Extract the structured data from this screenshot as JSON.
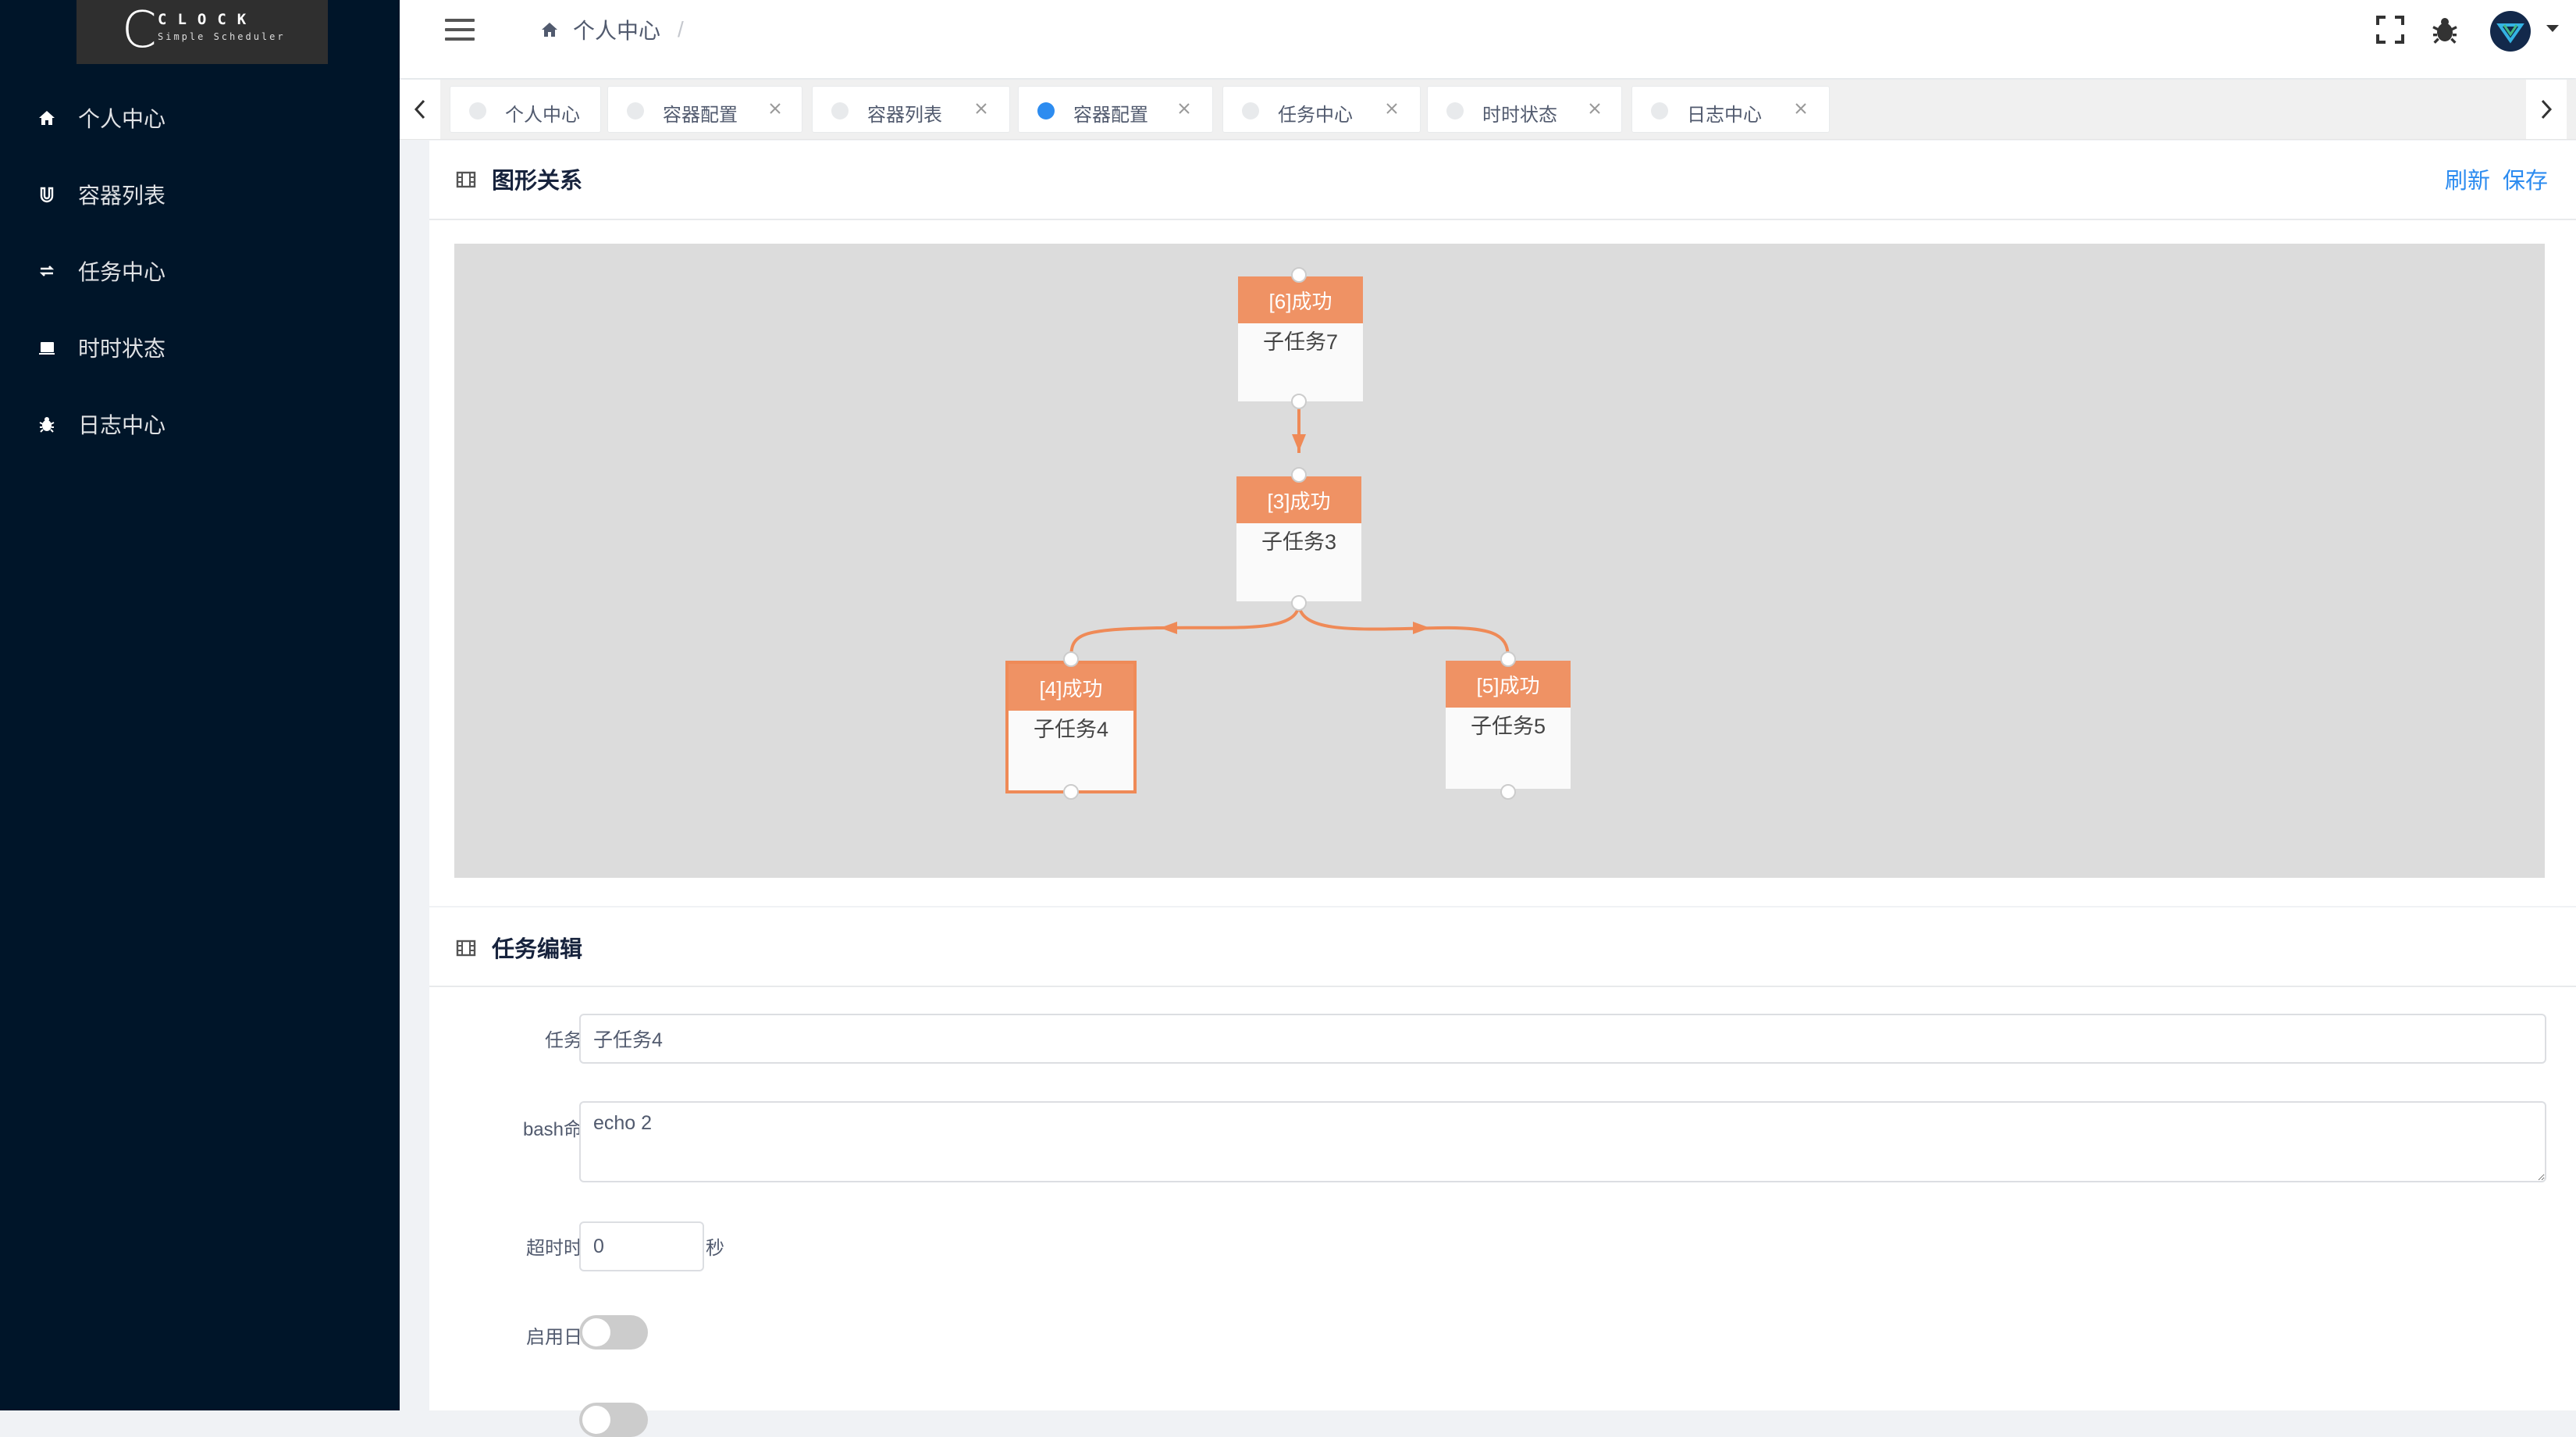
{
  "sidebar": {
    "logo": {
      "letter": "C",
      "word": "CLOCK",
      "subtitle": "Simple Scheduler"
    },
    "items": [
      {
        "label": "个人中心",
        "icon": "home-icon"
      },
      {
        "label": "容器列表",
        "icon": "magnet-icon"
      },
      {
        "label": "任务中心",
        "icon": "refresh-icon"
      },
      {
        "label": "时时状态",
        "icon": "monitor-icon"
      },
      {
        "label": "日志中心",
        "icon": "bug-icon"
      }
    ]
  },
  "header": {
    "breadcrumb": {
      "label": "个人中心",
      "separator": "/"
    },
    "icons": [
      "fullscreen-icon",
      "bug-icon",
      "avatar",
      "caret-down-icon"
    ]
  },
  "tabs": [
    {
      "label": "个人中心",
      "active": false,
      "closable": false
    },
    {
      "label": "容器配置",
      "active": false,
      "closable": true
    },
    {
      "label": "容器列表",
      "active": false,
      "closable": true
    },
    {
      "label": "容器配置",
      "active": true,
      "closable": true
    },
    {
      "label": "任务中心",
      "active": false,
      "closable": true
    },
    {
      "label": "时时状态",
      "active": false,
      "closable": true
    },
    {
      "label": "日志中心",
      "active": false,
      "closable": true
    }
  ],
  "graph_panel": {
    "title": "图形关系",
    "refresh_label": "刷新",
    "save_label": "保存",
    "nodes": [
      {
        "status": "[6]成功",
        "name": "子任务7"
      },
      {
        "status": "[3]成功",
        "name": "子任务3"
      },
      {
        "status": "[4]成功",
        "name": "子任务4",
        "selected": true
      },
      {
        "status": "[5]成功",
        "name": "子任务5"
      }
    ],
    "edges": [
      {
        "from": "子任务7",
        "to": "子任务3"
      },
      {
        "from": "子任务3",
        "to": "子任务4"
      },
      {
        "from": "子任务3",
        "to": "子任务5"
      }
    ]
  },
  "edit_panel": {
    "title": "任务编辑",
    "fields": {
      "name": {
        "label": "任务名",
        "value": "子任务4"
      },
      "command": {
        "label": "bash命令",
        "value": "echo 2"
      },
      "timeout": {
        "label": "超时时间",
        "value": "0",
        "unit": "秒"
      },
      "log": {
        "label": "启用日志",
        "enabled": false
      }
    }
  },
  "colors": {
    "sidebar_bg": "#001529",
    "node_header": "#ef9264",
    "edge": "#ef8a57",
    "link": "#2d8cf0",
    "active_tab_dot": "#2d8cf0"
  }
}
